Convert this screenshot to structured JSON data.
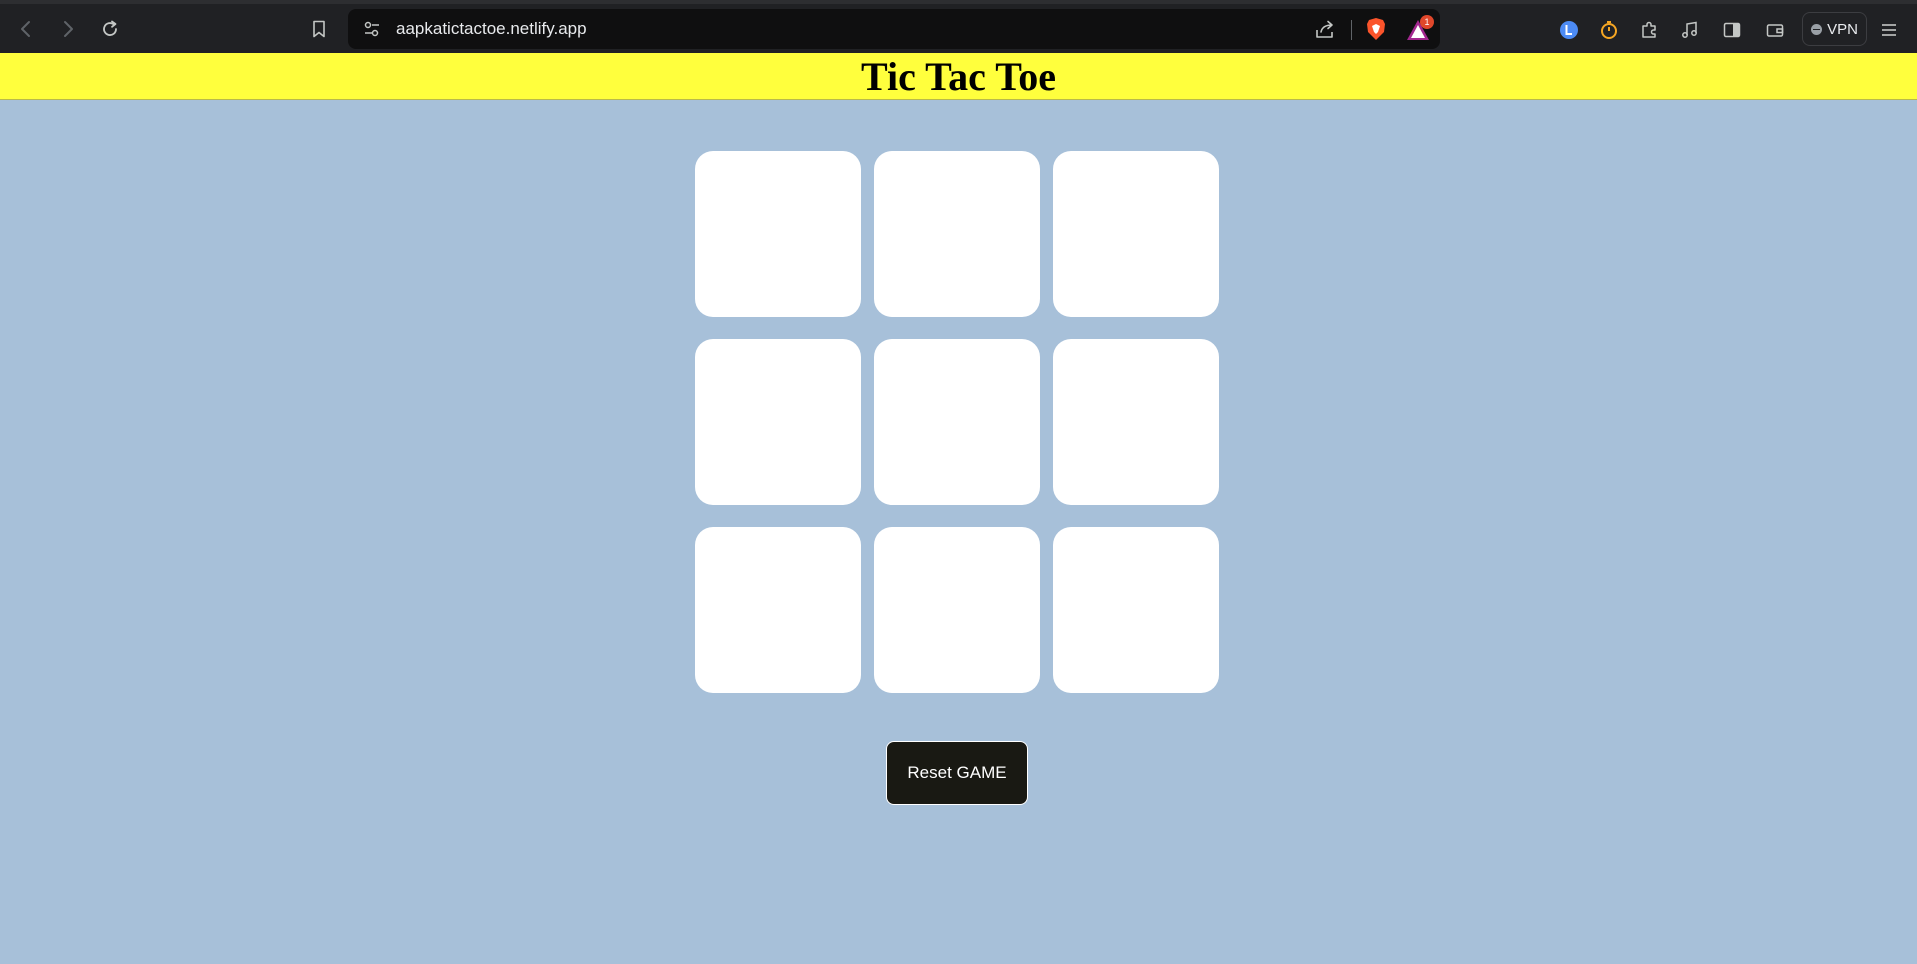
{
  "browser": {
    "url": "aapkatictactoe.netlify.app",
    "rewards_badge": "1",
    "vpn_label": "VPN"
  },
  "page": {
    "title": "Tic Tac Toe",
    "board": {
      "cells": [
        "",
        "",
        "",
        "",
        "",
        "",
        "",
        "",
        ""
      ]
    },
    "reset_label": "Reset GAME"
  },
  "colors": {
    "header_bg": "#ffff3d",
    "page_bg": "#a7c0d9",
    "cell_bg": "#ffffff",
    "button_bg": "#191913"
  }
}
